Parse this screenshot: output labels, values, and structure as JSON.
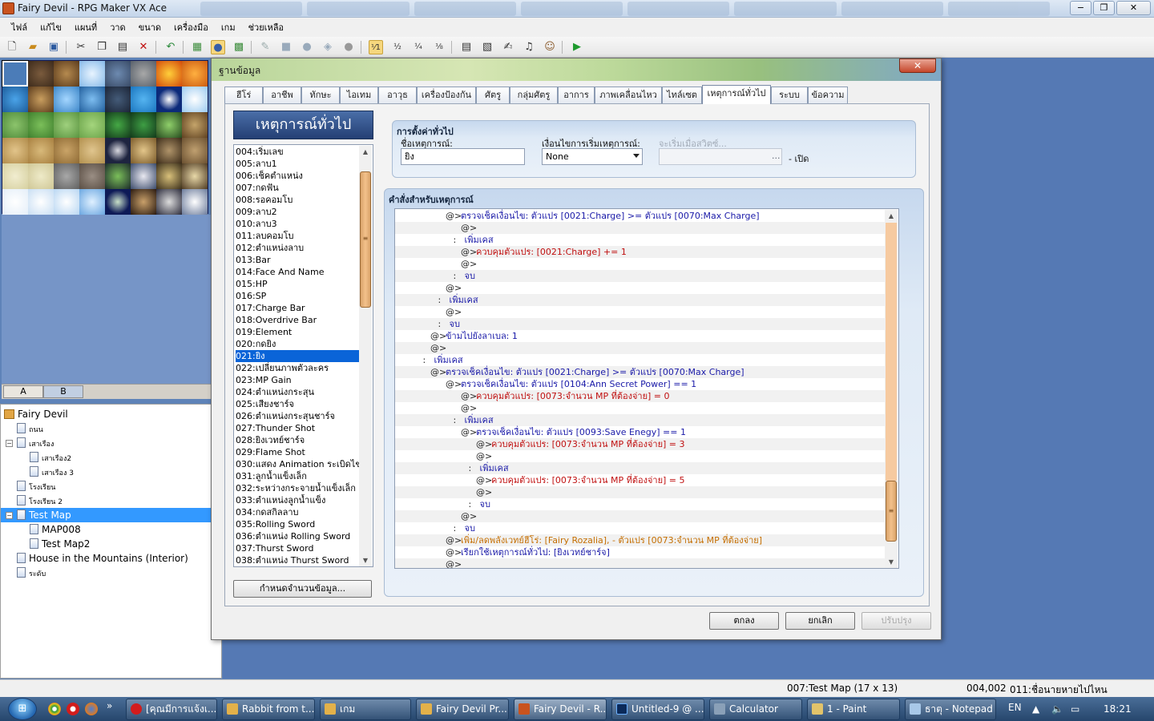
{
  "window": {
    "title": "Fairy Devil - RPG Maker VX Ace"
  },
  "menu": [
    "ไฟล์",
    "แก้ไข",
    "แผนที่",
    "วาด",
    "ขนาด",
    "เครื่องมือ",
    "เกม",
    "ช่วยเหลือ"
  ],
  "window_buttons": [
    "−",
    "❐",
    "✕"
  ],
  "toolbar_icons": [
    "new-icon",
    "open-icon",
    "save-icon",
    "cut-icon",
    "copy-icon",
    "paste-icon",
    "delete-icon",
    "undo-icon",
    "map-layer-icon",
    "event-layer-icon",
    "region-layer-icon",
    "pencil-icon",
    "rectangle-icon",
    "ellipse-icon",
    "fill-icon",
    "shadow-pen-icon",
    "zoom-1-1-icon",
    "zoom-1-2-icon",
    "zoom-1-4-icon",
    "zoom-1-8-icon",
    "database-icon",
    "resource-manager-icon",
    "script-editor-icon",
    "sound-test-icon",
    "character-generator-icon",
    "playtest-icon"
  ],
  "palette_tabs": {
    "a": "A",
    "b": "B"
  },
  "map_tree": [
    {
      "label": "Fairy Devil",
      "level": 0,
      "kind": "project"
    },
    {
      "label": "ถนน",
      "level": 1
    },
    {
      "label": "เสาเรือง",
      "level": 1,
      "expander": "−"
    },
    {
      "label": "เสาเรือง2",
      "level": 2
    },
    {
      "label": "เสาเรือง 3",
      "level": 2
    },
    {
      "label": "โรงเรียน",
      "level": 1
    },
    {
      "label": "โรงเรียน 2",
      "level": 1
    },
    {
      "label": "Test Map",
      "level": 1,
      "expander": "−",
      "selected": true
    },
    {
      "label": "MAP008",
      "level": 2
    },
    {
      "label": "Test Map2",
      "level": 2
    },
    {
      "label": "House in the Mountains (Interior)",
      "level": 1
    },
    {
      "label": "ระดับ",
      "level": 1
    }
  ],
  "dialog": {
    "title": "ฐานข้อมูล",
    "close": "✕",
    "tabs": [
      "ฮีโร่",
      "อาชีพ",
      "ทักษะ",
      "ไอเทม",
      "อาวุธ",
      "เครื่องป้องกัน",
      "ศัตรู",
      "กลุ่มศัตรู",
      "อาการ",
      "ภาพเคลื่อนไหว",
      "ไทล์เซต",
      "เหตุการณ์ทั่วไป",
      "ระบบ",
      "ข้อความ"
    ],
    "active_tab": "เหตุการณ์ทั่วไป",
    "list_header": "เหตุการณ์ทั่วไป",
    "common_events": [
      "004:เริ่มเลข",
      "005:ลาบ1",
      "006:เช็คตำแหน่ง",
      "007:กดฟัน",
      "008:รอคอมโบ",
      "009:ลาบ2",
      "010:ลาบ3",
      "011:ลบคอมโบ",
      "012:ตำแหน่งลาบ",
      "013:Bar",
      "014:Face And Name",
      "015:HP",
      "016:SP",
      "017:Charge Bar",
      "018:Overdrive Bar",
      "019:Element",
      "020:กดยิง",
      "021:ยิง",
      "022:เปลี่ยนภาพตัวละคร",
      "023:MP Gain",
      "024:ตำแหน่งกระสุน",
      "025:เสียงชาร์จ",
      "026:ตำแหน่งกระสุนชาร์จ",
      "027:Thunder Shot",
      "028:ยิงเวทย์ชาร์จ",
      "029:Flame Shot",
      "030:แสดง Animation ระเบิดไข",
      "031:ลูกน้ำแข็งเล็ก",
      "032:ระหว่างกระจายน้ำแข็งเล็ก",
      "033:ตำแหน่งลูกน้ำแข็ง",
      "034:กดสกิลลาบ",
      "035:Rolling Sword",
      "036:ตำแหน่ง Rolling Sword",
      "037:Thurst Sword",
      "038:ตำแหน่ง Thurst Sword"
    ],
    "selected_index": 17,
    "change_max_button": "กำหนดจำนวนข้อมูล...",
    "general_settings": {
      "title": "การตั้งค่าทั่วไป",
      "name_label": "ชื่อเหตุการณ์:",
      "name_value": "ยิง",
      "trigger_label": "เงื่อนไขการเริ่มเหตุการณ์:",
      "trigger_value": "None",
      "switch_label": "จะเริ่มเมื่อสวิตซ์...",
      "switch_value": "",
      "switch_browse": "...",
      "switch_suffix": "- เปิด"
    },
    "commands_title": "คำสั่งสำหรับเหตุการณ์",
    "commands": [
      {
        "indent": 3,
        "parts": [
          {
            "t": "@>",
            "c": "black"
          },
          {
            "t": "ตรวจเช็คเงื่อนไข: ตัวแปร [0021:Charge] >= ตัวแปร [0070:Max Charge]",
            "c": "blue"
          }
        ]
      },
      {
        "indent": 4,
        "parts": [
          {
            "t": "@>",
            "c": "black"
          }
        ]
      },
      {
        "indent": 3.5,
        "parts": [
          {
            "t": ":  ",
            "c": "black"
          },
          {
            "t": "เพิ่มเคส",
            "c": "blue"
          }
        ]
      },
      {
        "indent": 4,
        "parts": [
          {
            "t": "@>",
            "c": "black"
          },
          {
            "t": "ควบคุมตัวแปร: [0021:Charge] += 1",
            "c": "red"
          }
        ]
      },
      {
        "indent": 4,
        "parts": [
          {
            "t": "@>",
            "c": "black"
          }
        ]
      },
      {
        "indent": 3.5,
        "parts": [
          {
            "t": ":  ",
            "c": "black"
          },
          {
            "t": "จบ",
            "c": "blue"
          }
        ]
      },
      {
        "indent": 3,
        "parts": [
          {
            "t": "@>",
            "c": "black"
          }
        ]
      },
      {
        "indent": 2.5,
        "parts": [
          {
            "t": ":  ",
            "c": "black"
          },
          {
            "t": "เพิ่มเคส",
            "c": "blue"
          }
        ]
      },
      {
        "indent": 3,
        "parts": [
          {
            "t": "@>",
            "c": "black"
          }
        ]
      },
      {
        "indent": 2.5,
        "parts": [
          {
            "t": ":  ",
            "c": "black"
          },
          {
            "t": "จบ",
            "c": "blue"
          }
        ]
      },
      {
        "indent": 2,
        "parts": [
          {
            "t": "@>",
            "c": "black"
          },
          {
            "t": "ข้ามไปยังลาเบล: 1",
            "c": "blue"
          }
        ]
      },
      {
        "indent": 2,
        "parts": [
          {
            "t": "@>",
            "c": "black"
          }
        ]
      },
      {
        "indent": 1.5,
        "parts": [
          {
            "t": ":  ",
            "c": "black"
          },
          {
            "t": "เพิ่มเคส",
            "c": "blue"
          }
        ]
      },
      {
        "indent": 2,
        "parts": [
          {
            "t": "@>",
            "c": "black"
          },
          {
            "t": "ตรวจเช็คเงื่อนไข: ตัวแปร [0021:Charge] >= ตัวแปร [0070:Max Charge]",
            "c": "blue"
          }
        ]
      },
      {
        "indent": 3,
        "parts": [
          {
            "t": "@>",
            "c": "black"
          },
          {
            "t": "ตรวจเช็คเงื่อนไข: ตัวแปร [0104:Ann Secret Power] == 1",
            "c": "blue"
          }
        ]
      },
      {
        "indent": 4,
        "parts": [
          {
            "t": "@>",
            "c": "black"
          },
          {
            "t": "ควบคุมตัวแปร: [0073:จำนวน MP ที่ต้องจ่าย] = 0",
            "c": "red"
          }
        ]
      },
      {
        "indent": 4,
        "parts": [
          {
            "t": "@>",
            "c": "black"
          }
        ]
      },
      {
        "indent": 3.5,
        "parts": [
          {
            "t": ":  ",
            "c": "black"
          },
          {
            "t": "เพิ่มเคส",
            "c": "blue"
          }
        ]
      },
      {
        "indent": 4,
        "parts": [
          {
            "t": "@>",
            "c": "black"
          },
          {
            "t": "ตรวจเช็คเงื่อนไข: ตัวแปร [0093:Save Enegy] == 1",
            "c": "blue"
          }
        ]
      },
      {
        "indent": 5,
        "parts": [
          {
            "t": "@>",
            "c": "black"
          },
          {
            "t": "ควบคุมตัวแปร: [0073:จำนวน MP ที่ต้องจ่าย] = 3",
            "c": "red"
          }
        ]
      },
      {
        "indent": 5,
        "parts": [
          {
            "t": "@>",
            "c": "black"
          }
        ]
      },
      {
        "indent": 4.5,
        "parts": [
          {
            "t": ":  ",
            "c": "black"
          },
          {
            "t": "เพิ่มเคส",
            "c": "blue"
          }
        ]
      },
      {
        "indent": 5,
        "parts": [
          {
            "t": "@>",
            "c": "black"
          },
          {
            "t": "ควบคุมตัวแปร: [0073:จำนวน MP ที่ต้องจ่าย] = 5",
            "c": "red"
          }
        ]
      },
      {
        "indent": 5,
        "parts": [
          {
            "t": "@>",
            "c": "black"
          }
        ]
      },
      {
        "indent": 4.5,
        "parts": [
          {
            "t": ":  ",
            "c": "black"
          },
          {
            "t": "จบ",
            "c": "blue"
          }
        ]
      },
      {
        "indent": 4,
        "parts": [
          {
            "t": "@>",
            "c": "black"
          }
        ]
      },
      {
        "indent": 3.5,
        "parts": [
          {
            "t": ":  ",
            "c": "black"
          },
          {
            "t": "จบ",
            "c": "blue"
          }
        ]
      },
      {
        "indent": 3,
        "parts": [
          {
            "t": "@>",
            "c": "black"
          },
          {
            "t": "เพิ่ม/ลดพลังเวทย์ฮีโร่: [Fairy Rozalia], - ตัวแปร [0073:จำนวน MP ที่ต้องจ่าย]",
            "c": "orange"
          }
        ]
      },
      {
        "indent": 3,
        "parts": [
          {
            "t": "@>",
            "c": "black"
          },
          {
            "t": "เรียกใช้เหตุการณ์ทั่วไป: [ยิงเวทย์ชาร์จ]",
            "c": "blue"
          }
        ]
      },
      {
        "indent": 3,
        "parts": [
          {
            "t": "@>",
            "c": "black"
          }
        ]
      }
    ],
    "ok": "ตกลง",
    "cancel": "ยกเลิก",
    "apply": "ปรับปรุง"
  },
  "status": {
    "map": "007:Test Map (17 x 13)",
    "coords": "004,002",
    "event": "011:ชื่อนายหายไปไหน"
  },
  "taskbar": {
    "buttons": [
      "[คุณมีการแจ้งเ...",
      "Rabbit from t...",
      "เกม",
      "Fairy Devil Pr...",
      "Fairy Devil - R...",
      "Untitled-9 @ ...",
      "Calculator",
      "1 - Paint",
      "ธาตุ - Notepad"
    ],
    "lang": "EN",
    "time": "18:21",
    "chevron": "»"
  }
}
